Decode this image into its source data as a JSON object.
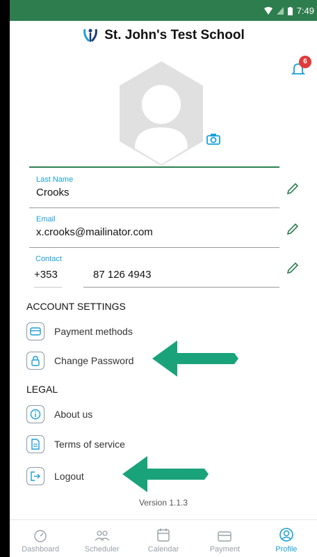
{
  "status": {
    "time": "7:49"
  },
  "header": {
    "school_name": "St. John's Test School"
  },
  "notifications": {
    "count": "6"
  },
  "profile": {
    "last_name": {
      "label": "Last Name",
      "value": "Crooks"
    },
    "email": {
      "label": "Email",
      "value": "x.crooks@mailinator.com"
    },
    "contact": {
      "label": "Contact",
      "code": "+353",
      "number": "87 126 4943"
    }
  },
  "account_settings": {
    "title": "ACCOUNT SETTINGS",
    "items": [
      {
        "label": "Payment methods",
        "icon": "card-icon"
      },
      {
        "label": "Change Password",
        "icon": "lock-icon"
      }
    ]
  },
  "legal": {
    "title": "LEGAL",
    "items": [
      {
        "label": "About us",
        "icon": "info-icon"
      },
      {
        "label": "Terms of service",
        "icon": "document-icon"
      },
      {
        "label": "Logout",
        "icon": "logout-icon"
      }
    ]
  },
  "version": "Version 1.1.3",
  "tabs": [
    {
      "label": "Dashboard",
      "icon": "dashboard-icon",
      "active": false
    },
    {
      "label": "Scheduler",
      "icon": "people-icon",
      "active": false
    },
    {
      "label": "Calendar",
      "icon": "calendar-icon",
      "active": false
    },
    {
      "label": "Payment",
      "icon": "card-icon",
      "active": false
    },
    {
      "label": "Profile",
      "icon": "profile-icon",
      "active": true
    }
  ],
  "colors": {
    "status_bar": "#2e7d4f",
    "accent": "#1aa0d8",
    "arrow": "#1aa37a",
    "badge": "#e03a3a"
  }
}
